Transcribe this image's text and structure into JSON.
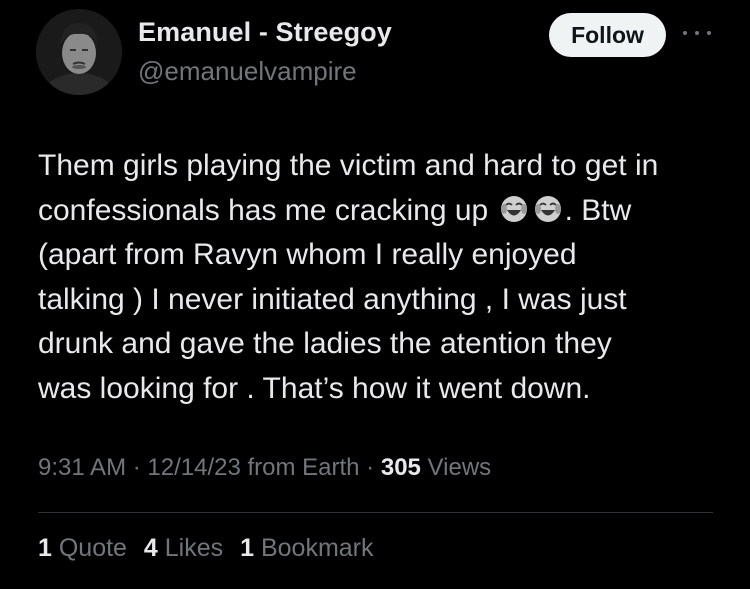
{
  "tweet": {
    "author": {
      "display_name": "Emanuel - Streegoy",
      "handle": "@emanuelvampire",
      "avatar_icon": "profile-photo"
    },
    "follow_label": "Follow",
    "more_icon": "more-horizontal-icon",
    "text_lines": [
      {
        "pre": "Them girls playing the victim and hard to get in",
        "post": ""
      },
      {
        "pre": "confessionals has me cracking up ",
        "post": ".  Btw"
      },
      {
        "pre": "(apart from Ravyn whom I really enjoyed",
        "post": ""
      },
      {
        "pre": "talking )  I never initiated anything , I was just",
        "post": ""
      },
      {
        "pre": "drunk and gave the ladies the atention they",
        "post": ""
      },
      {
        "pre": "was looking for . That’s how it went down.",
        "post": ""
      }
    ],
    "emojis": [
      "face-with-tears-of-joy",
      "face-with-tears-of-joy"
    ],
    "meta": {
      "time": "9:31 AM",
      "sep1": " · ",
      "date": "12/14/23",
      "source": " from Earth",
      "sep2": " · ",
      "views_count": "305",
      "views_label": " Views"
    },
    "stats": {
      "quotes_count": "1",
      "quotes_label": "Quote",
      "likes_count": "4",
      "likes_label": "Likes",
      "bookmarks_count": "1",
      "bookmarks_label": "Bookmark"
    }
  },
  "colors": {
    "background": "#000000",
    "text_primary": "#e7e9ea",
    "text_secondary": "#71767b",
    "button_bg": "#eff3f4",
    "divider": "#2f3336"
  }
}
